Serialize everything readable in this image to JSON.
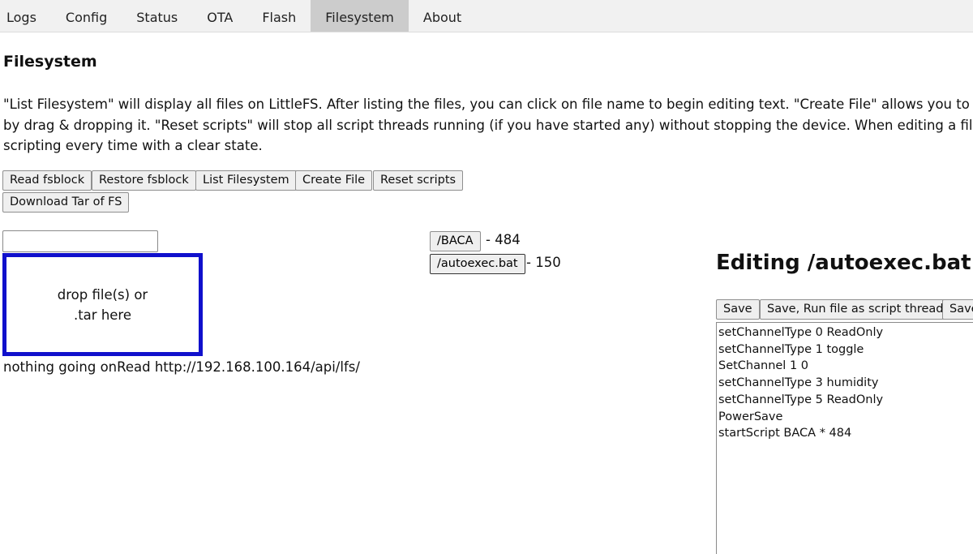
{
  "tabs": [
    {
      "label": "Logs"
    },
    {
      "label": "Config"
    },
    {
      "label": "Status"
    },
    {
      "label": "OTA"
    },
    {
      "label": "Flash"
    },
    {
      "label": "Filesystem",
      "active": true
    },
    {
      "label": "About"
    }
  ],
  "page": {
    "title": "Filesystem",
    "description_lines": [
      "\"List Filesystem\" will display all files on LittleFS. After listing the files, you can click on file name to begin editing text. \"Create File\" allows you to c",
      "by drag & dropping it. \"Reset scripts\" will stop all script threads running (if you have started any) without stopping the device. When editing a file",
      "scripting every time with a clear state."
    ]
  },
  "buttons": {
    "read_fsblock": "Read fsblock",
    "restore_fsblock": "Restore fsblock",
    "list_filesystem": "List Filesystem",
    "create_file": "Create File",
    "reset_scripts": "Reset scripts",
    "download_tar": "Download Tar of FS"
  },
  "upload": {
    "filename_value": "",
    "dropzone_text": "drop file(s) or .tar here",
    "status": "nothing going onRead http://192.168.100.164/api/lfs/"
  },
  "files": [
    {
      "name": "/BACA",
      "size_text": "- 484"
    },
    {
      "name": "/autoexec.bat",
      "size_text": "- 150",
      "selected": true
    }
  ],
  "editor": {
    "title": "Editing /autoexec.bat",
    "save_label": "Save",
    "save_run_label": "Save, Run file as script thread",
    "save_more_label": "Save",
    "content": "setChannelType 0 ReadOnly\nsetChannelType 1 toggle\nSetChannel 1 0\nsetChannelType 3 humidity\nsetChannelType 5 ReadOnly\nPowerSave\nstartScript BACA * 484"
  },
  "colors": {
    "dropzone_border": "#1010cc",
    "active_tab": "#cccccc",
    "tabbar_bg": "#f1f1f1"
  }
}
